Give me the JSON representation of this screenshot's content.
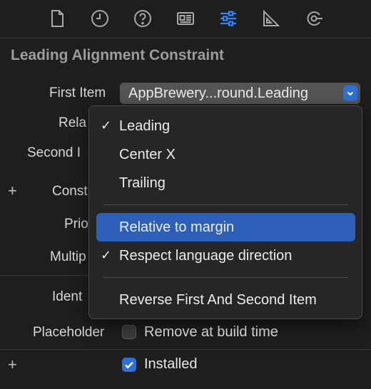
{
  "toolbar": {
    "icons": [
      "file-inspector-icon",
      "history-inspector-icon",
      "quick-help-icon",
      "identity-inspector-icon",
      "attributes-inspector-icon",
      "size-inspector-icon",
      "connections-inspector-icon"
    ],
    "active_color": "#2f86f6",
    "icon_color": "#a8a8a8"
  },
  "section_title": "Leading Alignment Constraint",
  "labels": {
    "first_item": "First Item",
    "relation": "Rela",
    "second_item": "Second I",
    "constant": "Const",
    "priority": "Prio",
    "multiplier": "Multip",
    "identifier": "Ident",
    "placeholder": "Placeholder"
  },
  "first_item_value": "AppBrewery...round.Leading",
  "placeholder_checkbox": {
    "label": "Remove at build time",
    "checked": false
  },
  "installed_checkbox": {
    "label": "Installed",
    "checked": true
  },
  "menu": {
    "items": [
      {
        "label": "Leading",
        "checked": true
      },
      {
        "label": "Center X",
        "checked": false
      },
      {
        "label": "Trailing",
        "checked": false
      },
      {
        "label": "Relative to margin",
        "checked": false,
        "highlighted": true
      },
      {
        "label": "Respect language direction",
        "checked": true
      },
      {
        "label": "Reverse First And Second Item",
        "checked": false
      }
    ],
    "check_glyph": "✓"
  },
  "plus_glyph": "+",
  "accent_color": "#2f6fd6"
}
